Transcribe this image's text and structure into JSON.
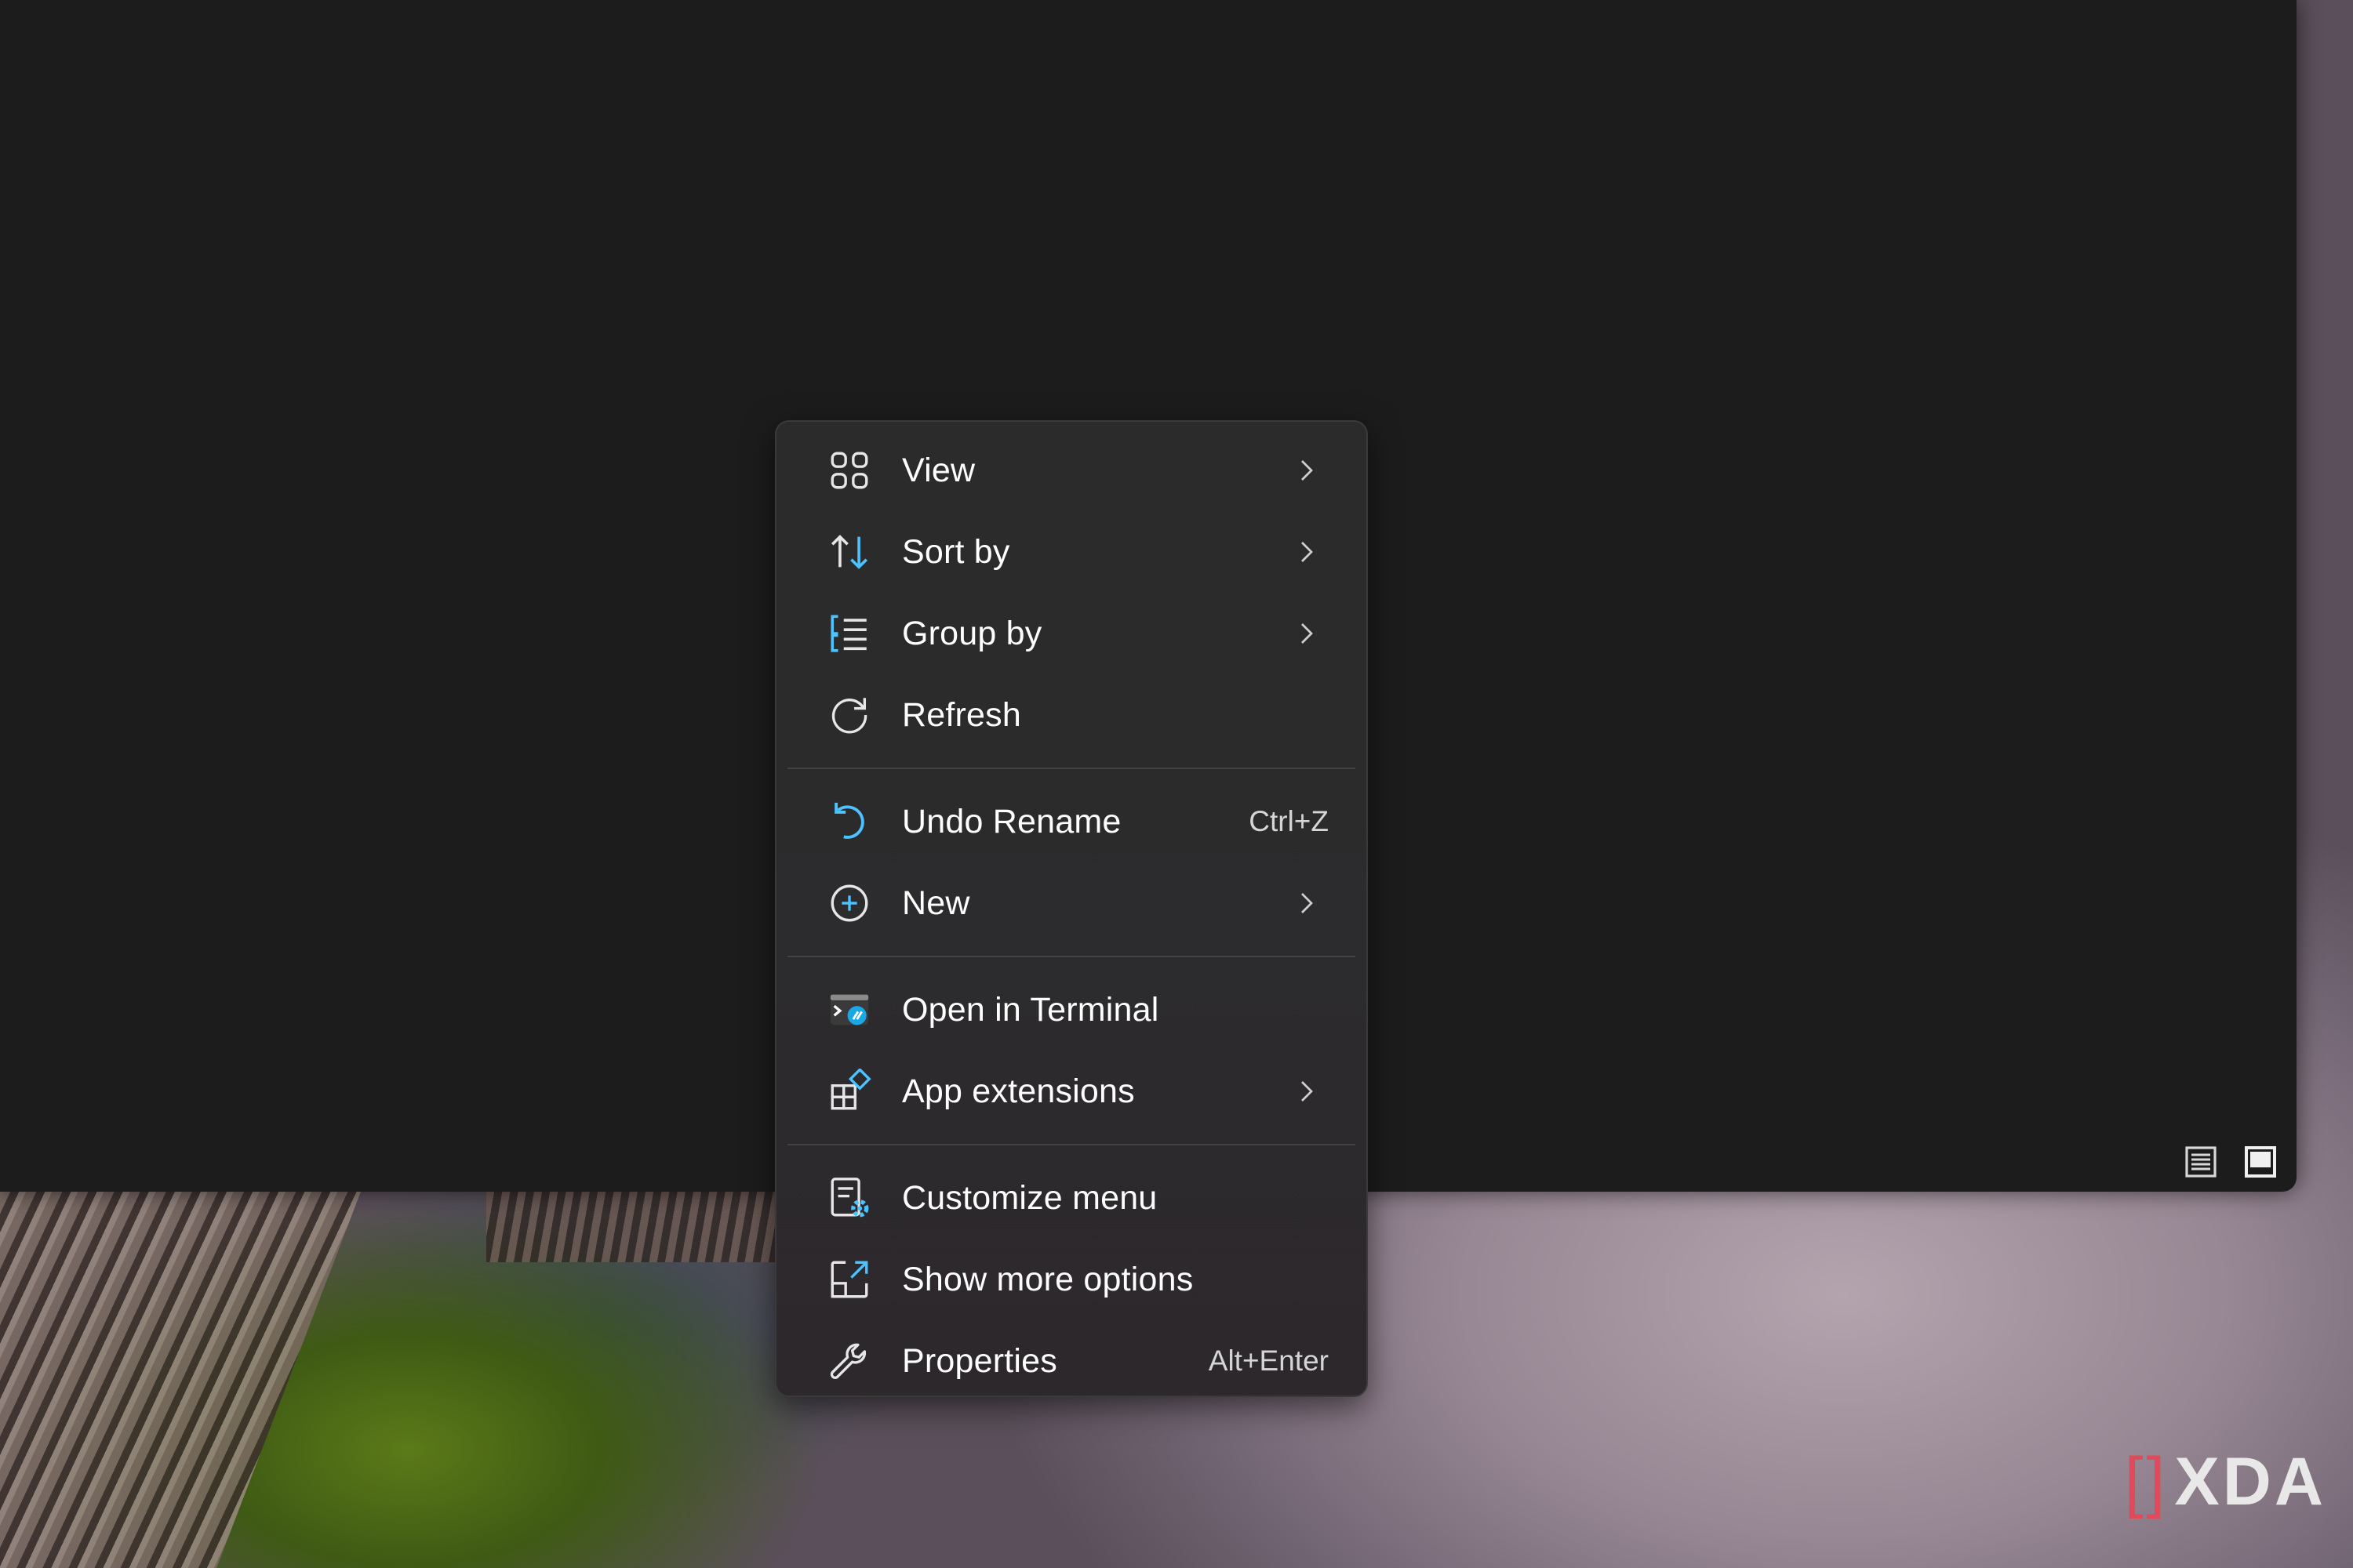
{
  "context_menu": {
    "items": [
      {
        "label": "View",
        "icon": "grid-icon",
        "submenu": true
      },
      {
        "label": "Sort by",
        "icon": "sort-icon",
        "submenu": true
      },
      {
        "label": "Group by",
        "icon": "group-list-icon",
        "submenu": true
      },
      {
        "label": "Refresh",
        "icon": "refresh-icon",
        "submenu": false
      },
      {
        "label": "Undo Rename",
        "icon": "undo-icon",
        "shortcut": "Ctrl+Z"
      },
      {
        "label": "New",
        "icon": "plus-circle-icon",
        "submenu": true
      },
      {
        "label": "Open in Terminal",
        "icon": "terminal-icon",
        "submenu": false
      },
      {
        "label": "App extensions",
        "icon": "app-extensions-icon",
        "submenu": true
      },
      {
        "label": "Customize menu",
        "icon": "customize-menu-icon",
        "submenu": false
      },
      {
        "label": "Show more options",
        "icon": "show-more-icon",
        "submenu": false
      },
      {
        "label": "Properties",
        "icon": "wrench-icon",
        "shortcut": "Alt+Enter"
      }
    ]
  },
  "watermark": {
    "text": "XDA"
  },
  "colors": {
    "accent": "#4cc2ff",
    "menu_bg": "#2b2b2b",
    "window_bg": "#1c1c1c"
  }
}
